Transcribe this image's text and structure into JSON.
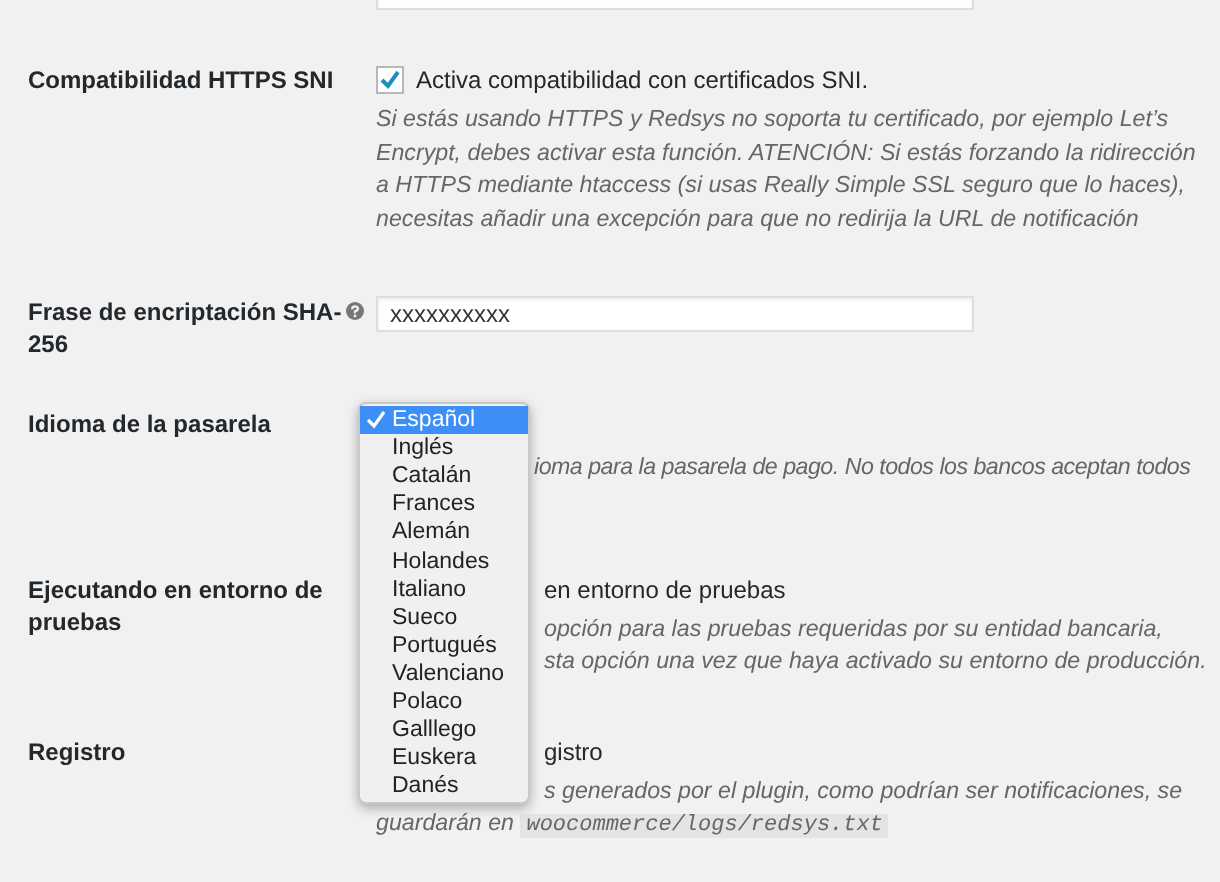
{
  "rows": [
    {
      "kind": "text",
      "value": ""
    },
    {
      "kind": "checkbox",
      "label": "Compatibilidad HTTPS SNI",
      "checked": true,
      "option": "Activa compatibilidad con certificados SNI.",
      "description": "Si estás usando HTTPS y Redsys no soporta tu certificado, por ejemplo Let’s Encrypt, debes activar esta función. ATENCIÓN: Si estás forzando la ridirección a HTTPS mediante htaccess (si usas Really Simple SSL seguro que lo haces), necesitas añadir una excepción para que no redirija la URL de notificación"
    },
    {
      "kind": "text",
      "label": "Frase de encriptación SHA-256",
      "help": true,
      "value": "xxxxxxxxxx"
    },
    {
      "kind": "select",
      "label": "Idioma de la pasarela",
      "description_lines": [
        "ioma para la pasarela de pago. No todos los bancos aceptan todos"
      ]
    },
    {
      "kind": "covered",
      "label": "Ejecutando en entorno de pruebas",
      "option": "en entorno de pruebas",
      "description_lines": [
        "opción para las pruebas requeridas por su entidad bancaria,",
        "sta opción una vez que haya activado su entorno de producción."
      ]
    },
    {
      "kind": "covered",
      "label": "Registro",
      "option": "gistro",
      "description_lines": [
        "s generados por el plugin, como podrían ser notificaciones, se"
      ],
      "tail": "guardarán en",
      "code": "woocommerce/logs/redsys.txt"
    }
  ],
  "dropdown": {
    "options": [
      {
        "label": "Español",
        "selected": true
      },
      {
        "label": "Inglés",
        "selected": false
      },
      {
        "label": "Catalán",
        "selected": false
      },
      {
        "label": "Frances",
        "selected": false
      },
      {
        "label": "Alemán",
        "selected": false
      },
      {
        "label": "Holandes",
        "selected": false
      },
      {
        "label": "Italiano",
        "selected": false
      },
      {
        "label": "Sueco",
        "selected": false
      },
      {
        "label": "Portugués",
        "selected": false
      },
      {
        "label": "Valenciano",
        "selected": false
      },
      {
        "label": "Polaco",
        "selected": false
      },
      {
        "label": "Galllego",
        "selected": false
      },
      {
        "label": "Euskera",
        "selected": false
      },
      {
        "label": "Danés",
        "selected": false
      }
    ]
  }
}
